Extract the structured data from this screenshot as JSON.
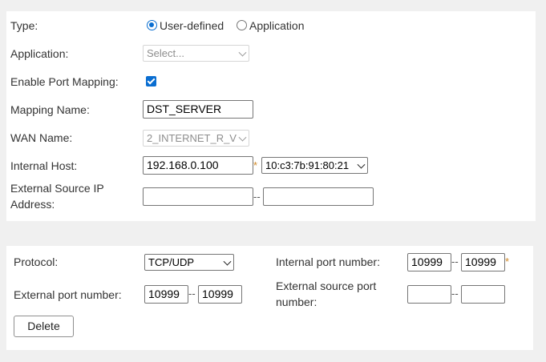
{
  "labels": {
    "type": "Type:",
    "application": "Application:",
    "enable_port_mapping": "Enable Port Mapping:",
    "mapping_name": "Mapping Name:",
    "wan_name": "WAN Name:",
    "internal_host": "Internal Host:",
    "external_source_ip": "External Source IP Address:",
    "protocol": "Protocol:",
    "internal_port": "Internal port number:",
    "external_port": "External port number:",
    "external_source_port": "External source port number:"
  },
  "type_options": {
    "user_defined": "User-defined",
    "application": "Application",
    "selected": "User-defined"
  },
  "application_select": {
    "value": "Select..."
  },
  "enable_port_mapping": {
    "checked": true
  },
  "mapping_name": {
    "value": "DST_SERVER"
  },
  "wan_name": {
    "value": "2_INTERNET_R_V"
  },
  "internal_host": {
    "ip": "192.168.0.100",
    "mac": "10:c3:7b:91:80:21"
  },
  "external_source_ip": {
    "start": "",
    "end": ""
  },
  "protocol": {
    "value": "TCP/UDP"
  },
  "internal_port": {
    "start": "10999",
    "end": "10999"
  },
  "external_port": {
    "start": "10999",
    "end": "10999"
  },
  "external_source_port": {
    "start": "",
    "end": ""
  },
  "symbols": {
    "range_separator": "--",
    "required_mark": "*"
  },
  "buttons": {
    "delete": "Delete"
  },
  "colors": {
    "accent": "#0a6ed1",
    "required": "#d08a2a"
  }
}
